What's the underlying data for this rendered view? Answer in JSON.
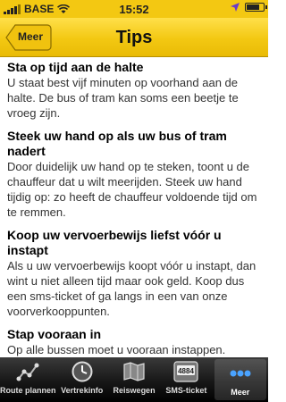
{
  "status_bar": {
    "carrier": "BASE",
    "time": "15:52",
    "battery_level": 0.8
  },
  "nav": {
    "back_label": "Meer",
    "title": "Tips"
  },
  "tips": [
    {
      "heading": "Sta op tijd aan de halte",
      "body": "U staat best vijf minuten op voorhand aan de halte. De bus of tram kan soms een beetje te vroeg zijn."
    },
    {
      "heading": "Steek uw hand op als uw bus of tram nadert",
      "body": "Door duidelijk uw hand op te steken, toont u de chauffeur dat u wilt meerijden. Steek uw hand tijdig op: zo heeft de chauffeur voldoende tijd om te remmen."
    },
    {
      "heading": "Koop uw vervoerbewijs liefst vóór u instapt",
      "body": "Als u uw vervoerbewijs koopt vóór u instapt, dan wint u niet alleen tijd maar ook geld. Koop dus een sms-ticket of ga langs in een van onze voorverkooppunten."
    },
    {
      "heading": "Stap vooraan in",
      "body": "Op alle bussen moet u vooraan instappen. Rolstoelgebruikers, mensen met een kinderwagen en mensen met een beperkte"
    }
  ],
  "tabbar": {
    "items": [
      {
        "label": "Route plannen",
        "icon": "route-icon"
      },
      {
        "label": "Vertrekinfo",
        "icon": "clock-icon"
      },
      {
        "label": "Reiswegen",
        "icon": "map-icon"
      },
      {
        "label": "SMS-ticket",
        "icon": "phone-4884-icon",
        "icon_text": "4884"
      },
      {
        "label": "Meer",
        "icon": "more-icon",
        "active": true
      }
    ]
  },
  "colors": {
    "brand_yellow": "#f3c812",
    "tabbar_bg": "#1a1a1a",
    "active_blue": "#4aa3ff"
  }
}
